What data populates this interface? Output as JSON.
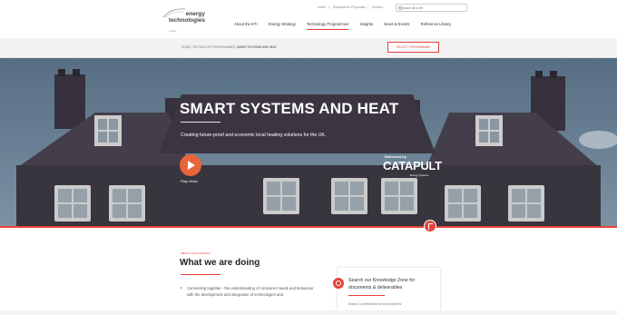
{
  "header": {
    "logo": {
      "line1": "energy",
      "line2": "technologies",
      "line3": "institute"
    },
    "util_links": [
      "Home",
      "Requests for Proposals",
      "Contact"
    ],
    "search": {
      "placeholder": "Search all on eti"
    },
    "nav": [
      "About the ETI",
      "Energy Strategy",
      "Technology Programmes",
      "Insights",
      "News & Events",
      "Reference Library"
    ],
    "active_nav_index": 2
  },
  "breadcrumb": [
    "HOME",
    "TECHNOLOGY PROGRAMMES",
    "SMART SYSTEMS AND HEAT"
  ],
  "select_programme_label": "SELECT PROGRAMME",
  "hero": {
    "title": "SMART SYSTEMS AND HEAT",
    "subtitle": "Creating future-proof and economic local heating solutions for the UK.",
    "play_label": "Play Video",
    "delivered_by": "Delivered by",
    "partner": "CATAPULT",
    "partner_sub": "Energy Systems"
  },
  "section": {
    "eyebrow": "ABOUT OUR CATAPULT",
    "title": "What we are doing",
    "body": "Connecting together - the understanding of consumer needs and behaviour with the development and integration of technologies and"
  },
  "knowledge": {
    "title": "Search our Knowledge Zone for documents & deliverables",
    "subtitle": "Search 11 deliverables for smart systems"
  },
  "colors": {
    "accent": "#e8413b",
    "play": "#e8643b",
    "text": "#333333"
  }
}
